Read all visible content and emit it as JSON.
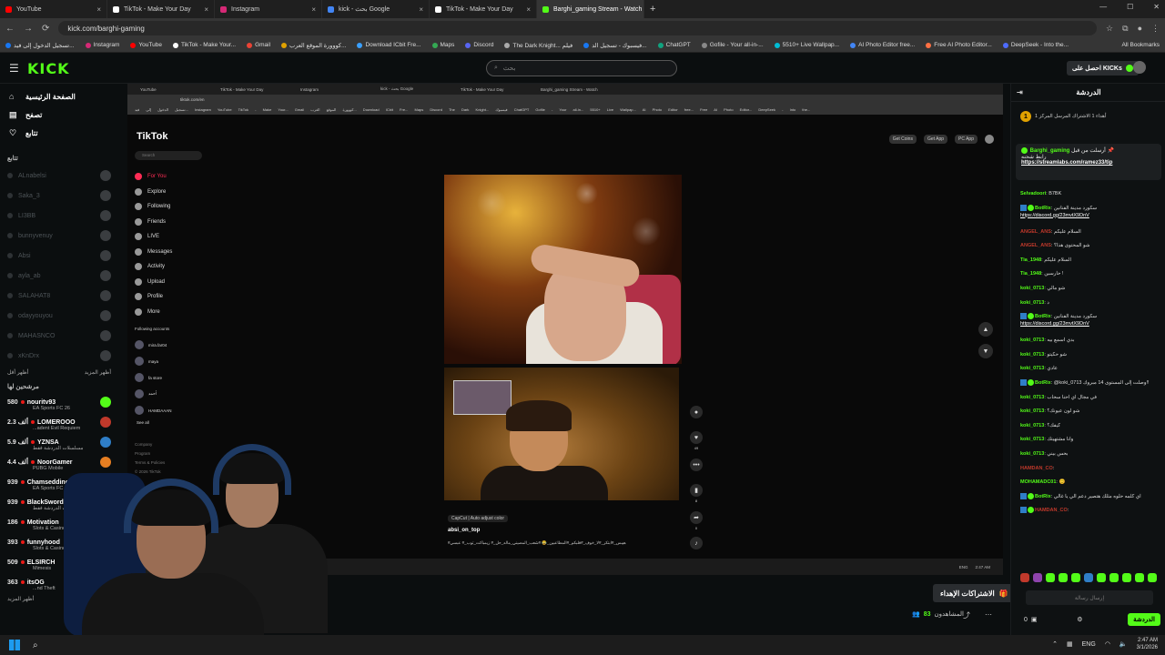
{
  "browser": {
    "tabs": [
      {
        "label": "YouTube",
        "color": "#ff0000"
      },
      {
        "label": "TikTok - Make Your Day",
        "color": "#ffffff"
      },
      {
        "label": "Instagram",
        "color": "#d62976"
      },
      {
        "label": "kick - بحث Google",
        "color": "#4285f4"
      },
      {
        "label": "TikTok - Make Your Day",
        "color": "#ffffff"
      },
      {
        "label": "Barghi_gaming Stream - Watch",
        "color": "#53fc18"
      }
    ],
    "url": "kick.com/barghi-gaming",
    "bookmarks": [
      "تسجيل الدخول إلى فيد...",
      "Instagram",
      "YouTube",
      "TikTok - Make Your...",
      "Gmail",
      "كووورة الموقع العرب...",
      "Download ICbit Fre...",
      "Maps",
      "Discord",
      "The Dark Knight... فيلم",
      "فيسبوك - تسجيل الد...",
      "ChatGPT",
      "Gofile - Your all-in-...",
      "5510+ Live Wallpap...",
      "AI Photo Editor free...",
      "Free AI Photo Editor...",
      "DeepSeek - Into the..."
    ],
    "all_bookmarks": "All Bookmarks"
  },
  "header": {
    "logo": "KICK",
    "search_placeholder": "بحث",
    "get_kicks": "احصل على KICKs"
  },
  "sidebar": {
    "nav": [
      {
        "label": "الصفحة الرئيسية",
        "icon": "home-icon"
      },
      {
        "label": "تصفح",
        "icon": "browse-icon"
      },
      {
        "label": "تتابع",
        "icon": "heart-icon"
      }
    ],
    "following_heading": "تتابع",
    "following": [
      "ALnabelsi",
      "Saka_3",
      "LI3BB",
      "bunnyvenuy",
      "Absi",
      "ayla_ab",
      "SALAHAT8",
      "odayyouyou",
      "MAHASNCO",
      "xKnDrx"
    ],
    "show_more": "أظهر المزيد",
    "show_less": "أظهر أقل",
    "recommended_heading": "مرشحين لها",
    "recommended": [
      {
        "count": "580",
        "name": "nouritv93",
        "sub": "EA Sports FC 26",
        "color": "#53fc18"
      },
      {
        "count": "2.3 ألف",
        "name": "LOMEROOO",
        "sub": "...adent Evil Requiem",
        "color": "#c0392b"
      },
      {
        "count": "5.9 ألف",
        "name": "YZNSA",
        "sub": "مسلسلات الدردشة فقط",
        "color": "#2f7ec7"
      },
      {
        "count": "4.4 ألف",
        "name": "NoorGamer",
        "sub": "PUBG Mobile",
        "color": "#e67e22"
      },
      {
        "count": "939",
        "name": "Chamseddinech",
        "sub": "EA Sports FC 26",
        "color": "#8e44ad"
      },
      {
        "count": "939",
        "name": "BlackSwordz",
        "sub": "مسلسلات الدردشة فقط",
        "color": "#16a085"
      },
      {
        "count": "186",
        "name": "Motivation",
        "sub": "Slots & Casino",
        "color": "#c0392b"
      },
      {
        "count": "393",
        "name": "funnyhood",
        "sub": "Slots & Casino",
        "color": "#7f8c8d"
      },
      {
        "count": "509",
        "name": "ELSIRCH",
        "sub": "Mimesis",
        "color": "#d35400"
      },
      {
        "count": "363",
        "name": "itsOG",
        "sub": "...nd Theft",
        "color": "#2c3e50"
      }
    ],
    "show_more_bottom": "أظهر المزيد"
  },
  "stream": {
    "inner_tabs": [
      "YouTube",
      "TikTok - Make Your Day",
      "Instagram",
      "kick - بحث Google",
      "TikTok - Make Your Day",
      "Barghi_gaming Stream - Watch"
    ],
    "inner_url": "tiktok.com/en",
    "inner_bookmarks": "تسجيل الدخول إلى فيد... Instagram YouTube TikTok - Make Your... Gmail كووورة الموقع العرب... Download ICbit Fre... Maps Discord The Dark Knight... فيسبوك ChatGPT Gofile - Your all-in... 5510+ Live Wallpap... AI Photo Editor free... Free AI Photo Editor... DeepSeek - Into the...",
    "tiktok": {
      "logo": "TikTok",
      "search_placeholder": "Search",
      "nav": [
        "For You",
        "Explore",
        "Following",
        "Friends",
        "LIVE",
        "Messages",
        "Activity",
        "Upload",
        "Profile",
        "More"
      ],
      "following_accounts_label": "Following accounts",
      "accounts": [
        "mira.far04",
        "maya",
        "fa store",
        "أحمد",
        "HAMDAAAN"
      ],
      "see_all": "See all",
      "footer": [
        "Company",
        "Program",
        "Terms & Policies",
        "© 2026 TikTok"
      ],
      "top_buttons": [
        "Get Coins",
        "Get App",
        "PC App"
      ],
      "capcut_label": "CapCut | Auto adjust color",
      "author": "absi_on_top",
      "description": "#هيبس_#ابتكر_#لا_خوف_#قلبكم_#المطاعبين_😂 #شعب_المصيني_ماله_حل_# زيمباكت_توب_# عبسي",
      "action_counts": [
        "",
        "49",
        "",
        "8",
        "0",
        ""
      ]
    },
    "gifts_button": "الاشتراكات الإهداء",
    "viewers": "83",
    "viewers_label": "المشاهدون"
  },
  "chat": {
    "title": "الدردشة",
    "goal_text": "أهداء 1 الاشتراك المرسل المركز 1",
    "pinned_user": "Barghi_gaming",
    "pinned_label": "أرسلت من قبل",
    "pinned_text": "رابط شحنه",
    "pinned_link": "https://streamlabs.com/ramez33/tip",
    "messages": [
      {
        "user": "Selvadoori",
        "color": "#53fc18",
        "text": "B7BK",
        "bot": false
      },
      {
        "user": "BotRix",
        "color": "#53fc18",
        "text": "سكورد مدينة الفنانين",
        "link": "https://discord.gg/23mvtX9DnV",
        "bot": true
      },
      {
        "user": "ANGEL_ANS",
        "color": "#c0392b",
        "text": "السلام عليكم",
        "bot": false
      },
      {
        "user": "ANGEL_ANS",
        "color": "#c0392b",
        "text": "شو المحتوى هذا؟",
        "bot": false
      },
      {
        "user": "Tia_1948",
        "color": "#53fc18",
        "text": "السلام عليكم",
        "bot": false
      },
      {
        "user": "Tia_1948",
        "color": "#53fc18",
        "text": "حارسين !",
        "bot": false
      },
      {
        "user": "koki_0713",
        "color": "#53fc18",
        "text": "شو مالي",
        "bot": false
      },
      {
        "user": "koki_0713",
        "color": "#53fc18",
        "text": "د",
        "bot": false
      },
      {
        "user": "BotRix",
        "color": "#53fc18",
        "text": "سكورد مدينة الفنانين",
        "link": "https://discord.gg/23mvtX9DnV",
        "bot": true
      },
      {
        "user": "koki_0713",
        "color": "#53fc18",
        "text": "بدي اسمع بيه",
        "bot": false
      },
      {
        "user": "koki_0713",
        "color": "#53fc18",
        "text": "شو حكيتو",
        "bot": false
      },
      {
        "user": "koki_0713",
        "color": "#53fc18",
        "text": "عادي",
        "bot": false
      },
      {
        "user": "BotRix",
        "color": "#53fc18",
        "text": "@koki_0713 وصلت إلى المستوى 14 مبروك!!",
        "bot": true
      },
      {
        "user": "koki_0713",
        "color": "#53fc18",
        "text": "في مجال اي احنا سحاب",
        "bot": false
      },
      {
        "user": "koki_0713",
        "color": "#53fc18",
        "text": "شو لون عيونك؟",
        "bot": false
      },
      {
        "user": "koki_0713",
        "color": "#53fc18",
        "text": "كيفك؟",
        "bot": false
      },
      {
        "user": "koki_0713",
        "color": "#53fc18",
        "text": "وانا مشتهيتك",
        "bot": false
      },
      {
        "user": "koki_0713",
        "color": "#53fc18",
        "text": "بحس بيني",
        "bot": false
      },
      {
        "user": "HAMDAN_CO",
        "color": "#c0392b",
        "text": "",
        "bot": false
      },
      {
        "user": "MOHAMADC01",
        "color": "#53fc18",
        "text": "😊",
        "bot": false
      },
      {
        "user": "BotRix",
        "color": "#53fc18",
        "text": "اي كلمه حلوه مثلك هتصير دعم الي يا غالي",
        "bot": true
      },
      {
        "user": "HAMDAN_CO",
        "color": "#c0392b",
        "text": "",
        "bot": true
      }
    ],
    "input_placeholder": "إرسال رسالة",
    "send_label": "الدردشة",
    "points": "0"
  },
  "taskbar": {
    "lang": "ENG",
    "time": "2:47 AM",
    "date": "3/1/2026"
  }
}
